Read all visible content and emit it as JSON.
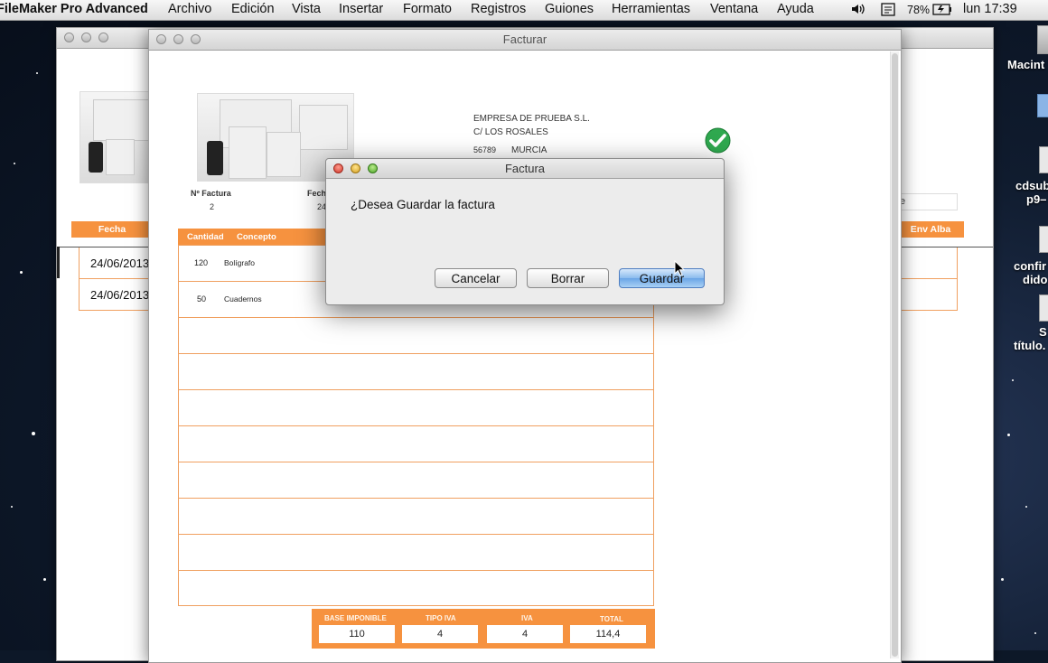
{
  "menubar": {
    "app_name": "FileMaker Pro Advanced",
    "items": [
      "Archivo",
      "Edición",
      "Vista",
      "Insertar",
      "Formato",
      "Registros",
      "Guiones",
      "Herramientas",
      "Ventana",
      "Ayuda"
    ],
    "battery": "78%",
    "clock": "lun 17:39"
  },
  "desktop": {
    "icons": [
      "Macint",
      "cdsub",
      "p9–",
      "confir",
      "dido",
      "S",
      "título."
    ]
  },
  "back_window": {
    "col_fecha": "Fecha",
    "col_env": "Env Alba",
    "partial_text": "e",
    "rows": [
      {
        "fecha": "24/06/2013"
      },
      {
        "fecha": "24/06/2013"
      }
    ]
  },
  "front_window": {
    "title": "Facturar",
    "company": {
      "name": "EMPRESA DE PRUEBA S.L.",
      "street": "C/ LOS ROSALES",
      "postal": "56789",
      "city": "MURCIA"
    },
    "invoice_no_label": "Nº Factura",
    "invoice_no": "2",
    "date_label": "Fech",
    "date_value": "24",
    "lines_header": {
      "cantidad": "Cantidad",
      "concepto": "Concepto"
    },
    "lines": [
      {
        "cantidad": "120",
        "concepto": "Bolígrafo"
      },
      {
        "cantidad": "50",
        "concepto": "Cuadernos"
      }
    ],
    "totals": {
      "base_label": "BASE IMPONIBLE",
      "base": "110",
      "tipo_label": "TIPO IVA",
      "tipo": "4",
      "iva_label": "IVA",
      "iva": "4",
      "total_label": "TOTAL",
      "total": "114,4"
    }
  },
  "dialog": {
    "title": "Factura",
    "message": "¿Desea Guardar la factura",
    "cancel": "Cancelar",
    "delete": "Borrar",
    "save": "Guardar"
  },
  "colors": {
    "accent": "#f6923f",
    "check": "#2fa84f"
  }
}
